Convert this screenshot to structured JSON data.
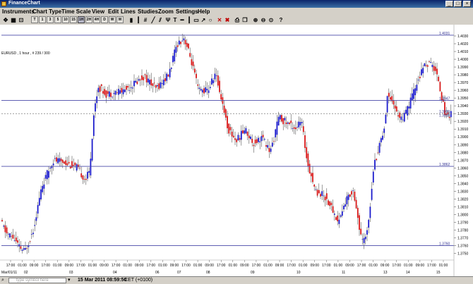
{
  "window": {
    "title": "FinanceChart"
  },
  "menu": [
    "Instruments",
    "Chart Type",
    "Time Scale",
    "View",
    "Edit",
    "Lines",
    "Studies",
    "Zoom",
    "Settings",
    "Help"
  ],
  "toolbar": {
    "timeframes": [
      "T",
      "1",
      "3",
      "5",
      "10",
      "15",
      "1H",
      "2H",
      "4H",
      "D",
      "W",
      "M"
    ],
    "selected_timeframe": "1H"
  },
  "chart": {
    "info": "EURUSD , 1 hour , # 239 / 300",
    "price_ticks": [
      "1.4030",
      "1.4020",
      "1.4010",
      "1.4000",
      "1.3990",
      "1.3980",
      "1.3970",
      "1.3960",
      "1.3950",
      "1.3940",
      "1.3930",
      "1.3920",
      "1.3910",
      "1.3900",
      "1.3890",
      "1.3880",
      "1.3870",
      "1.3860",
      "1.3850",
      "1.3840",
      "1.3830",
      "1.3820",
      "1.3810",
      "1.3800",
      "1.3790",
      "1.3780",
      "1.3770",
      "1.3760",
      "1.3750"
    ],
    "level_labels": {
      "l4031": "1.4031",
      "l3947": "1.3947",
      "l3930": "1.3930",
      "l3925": "1.3925",
      "l3862": "1.3862",
      "l3760": "1.3760"
    },
    "time_labels": [
      "17:00",
      "01:00",
      "09:00",
      "17:00",
      "01:00",
      "09:00",
      "17:00",
      "01:00",
      "09:00",
      "17:00",
      "01:00",
      "09:00",
      "17:00",
      "01:00",
      "09:00",
      "17:00",
      "01:00",
      "09:00",
      "17:00",
      "01:00",
      "09:00",
      "17:00",
      "01:00",
      "09:00",
      "17:00",
      "01:00",
      "09:00",
      "17:00",
      "01:00",
      "09:00",
      "17:00",
      "01:00",
      "09:00",
      "17:00",
      "01:00",
      "09:00",
      "17:00",
      "01:00"
    ],
    "date_labels": [
      "Mar/01/11",
      "02",
      "03",
      "04",
      "06",
      "07",
      "08",
      "09",
      "10",
      "11",
      "13",
      "14",
      "15"
    ]
  },
  "chart_data": {
    "type": "candlestick",
    "symbol": "EURUSD",
    "ylim": [
      1.3745,
      1.404
    ],
    "horizontal_lines": [
      1.4031,
      1.3947,
      1.3862,
      1.376
    ],
    "dashed_lines": [
      1.393
    ],
    "colors": {
      "up": "#1a1acc",
      "down": "#d81818",
      "line": "#4848a8"
    }
  },
  "status": {
    "symbol_placeholder": "type symbol here",
    "time": "15 Mar 2011 08:59:50",
    "timezone": "CET (+0100)"
  }
}
